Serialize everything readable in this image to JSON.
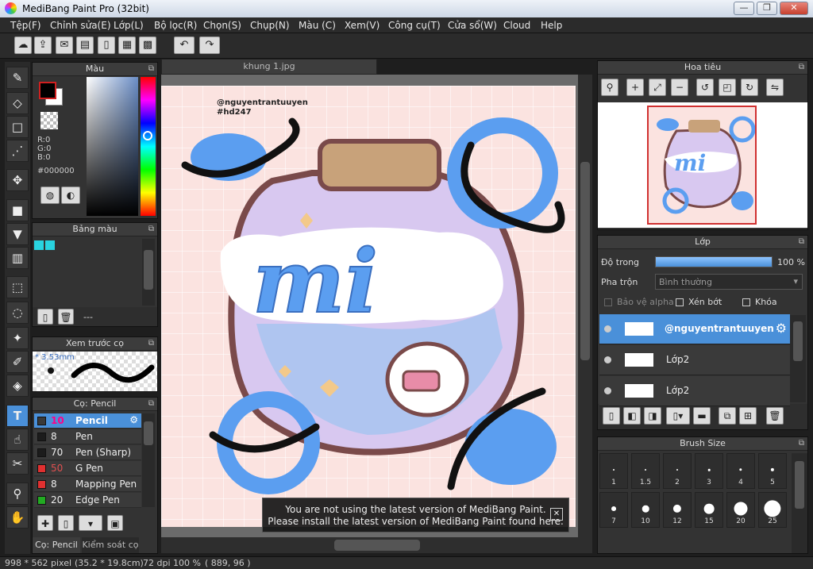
{
  "window": {
    "title": "MediBang Paint Pro (32bit)",
    "minimize": "—",
    "maximize": "❐",
    "close": "✕"
  },
  "menu": [
    "Tệp(F)",
    "Chỉnh sửa(E)",
    "Lớp(L)",
    "Bộ lọc(R)",
    "Chọn(S)",
    "Chụp(N)",
    "Màu (C)",
    "Xem(V)",
    "Công cụ(T)",
    "Cửa sổ(W)",
    "Cloud",
    "Help"
  ],
  "color_panel": {
    "title": "Màu",
    "r": "R:0",
    "g": "G:0",
    "b": "B:0",
    "hex": "#000000",
    "fg": "#000000",
    "bg": "#ffffff"
  },
  "palette_panel": {
    "title": "Bảng màu",
    "swatches": [
      "#29d3df",
      "#29d3df"
    ],
    "dash": "---"
  },
  "brush_preview": {
    "title": "Xem trước cọ",
    "size": "* 3.53mm"
  },
  "brush_panel": {
    "title": "Cọ: Pencil",
    "items": [
      {
        "size": "10",
        "name": "Pencil",
        "color": "#3a3a3a",
        "selected": true
      },
      {
        "size": "8",
        "name": "Pen",
        "color": "#1c1c1c"
      },
      {
        "size": "70",
        "name": "Pen (Sharp)",
        "color": "#1c1c1c"
      },
      {
        "size": "50",
        "name": "G Pen",
        "color": "#e03030"
      },
      {
        "size": "8",
        "name": "Mapping Pen",
        "color": "#e03030"
      },
      {
        "size": "20",
        "name": "Edge Pen",
        "color": "#22aa22"
      }
    ],
    "tabs": [
      "Cọ: Pencil",
      "Kiểm soát cọ"
    ]
  },
  "canvas": {
    "tab": "khung 1.jpg",
    "credit1": "@nguyentrantuuyen",
    "credit2": "#hd247",
    "art_text": "mi"
  },
  "notice": {
    "line1": "You are not using the latest version of MediBang Paint.",
    "line2": "Please install the latest version of MediBang Paint found here.",
    "close": "✕"
  },
  "navigator": {
    "title": "Hoa tiêu"
  },
  "layer_panel": {
    "title": "Lớp",
    "opacity_label": "Độ trong",
    "opacity_value": "100 %",
    "opacity": 1.0,
    "blend_label": "Pha trộn",
    "blend_value": "Bình thường",
    "protect_alpha": "Bảo vệ alpha",
    "clipping": "Xén bớt",
    "lock": "Khóa",
    "layers": [
      {
        "name": "@nguyentrantuuyen",
        "selected": true
      },
      {
        "name": "Lớp2"
      },
      {
        "name": "Lớp2"
      }
    ]
  },
  "brush_size": {
    "title": "Brush Size",
    "sizes": [
      "1",
      "1.5",
      "2",
      "3",
      "4",
      "5",
      "7",
      "10",
      "12",
      "15",
      "20",
      "25"
    ]
  },
  "status": {
    "dims": "998 * 562 pixel",
    "cm": "(35.2 * 19.8cm)",
    "dpi": "72 dpi",
    "zoom": "100 %",
    "coords": "( 889, 96 )"
  }
}
